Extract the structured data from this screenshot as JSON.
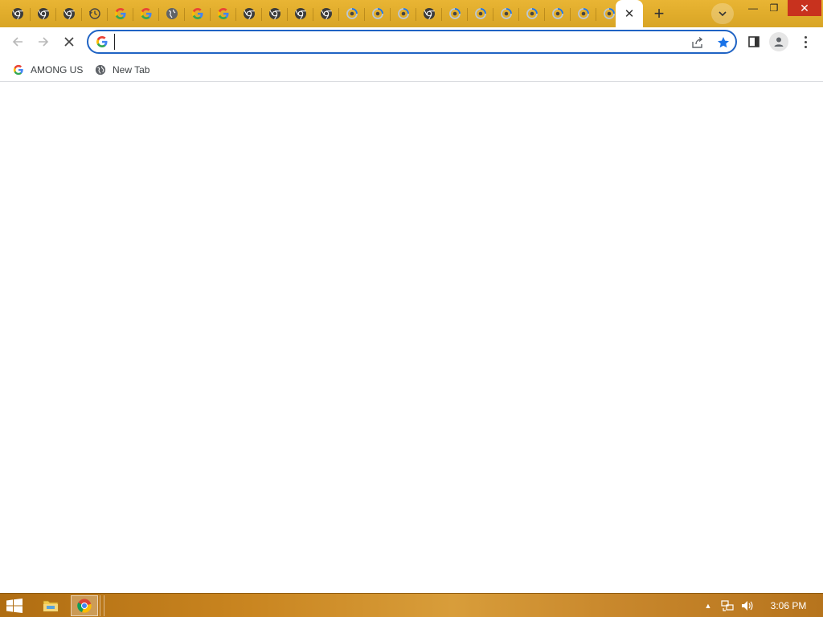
{
  "browser": {
    "tabs": [
      {
        "icon": "chrome-icon"
      },
      {
        "icon": "chrome-icon"
      },
      {
        "icon": "chrome-icon"
      },
      {
        "icon": "history-icon"
      },
      {
        "icon": "google-icon"
      },
      {
        "icon": "google-icon"
      },
      {
        "icon": "globe-icon"
      },
      {
        "icon": "google-icon"
      },
      {
        "icon": "google-icon"
      },
      {
        "icon": "chrome-icon"
      },
      {
        "icon": "chrome-icon"
      },
      {
        "icon": "chrome-icon"
      },
      {
        "icon": "chrome-icon"
      },
      {
        "icon": "loading-icon"
      },
      {
        "icon": "loading-icon"
      },
      {
        "icon": "loading-icon"
      },
      {
        "icon": "chrome-icon"
      },
      {
        "icon": "loading-icon"
      },
      {
        "icon": "loading-icon"
      },
      {
        "icon": "loading-icon"
      },
      {
        "icon": "loading-icon"
      },
      {
        "icon": "loading-icon"
      },
      {
        "icon": "loading-icon"
      },
      {
        "icon": "loading-icon"
      }
    ],
    "active_tab_close": "✕",
    "new_tab_symbol": "+",
    "window_controls": {
      "minimize": "—",
      "maximize": "❐",
      "close": "✕"
    }
  },
  "toolbar": {
    "address_value": "",
    "address_placeholder": ""
  },
  "bookmarks": [
    {
      "label": "AMONG US",
      "icon": "google-icon"
    },
    {
      "label": "New Tab",
      "icon": "globe-icon"
    }
  ],
  "taskbar": {
    "clock": "3:06 PM",
    "tray_arrow": "▲"
  },
  "colors": {
    "tabstrip": "#e0ab2a",
    "omnibox_border": "#1f63c4",
    "star": "#1a73e8",
    "taskbar": "#c98520",
    "close_button": "#c8321e"
  }
}
